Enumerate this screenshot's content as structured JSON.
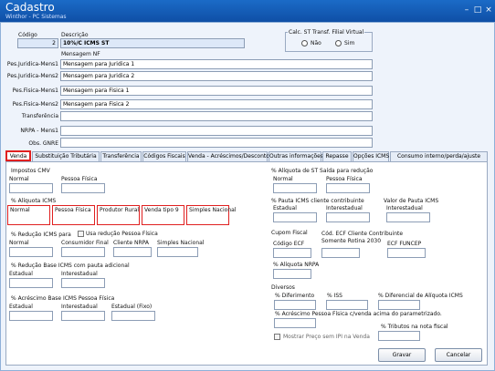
{
  "window": {
    "title": "Cadastro",
    "subtitle": "Winthor - PC Sistemas"
  },
  "header": {
    "codigo_label": "Código",
    "codigo_value": "2",
    "descricao_label": "Descrição",
    "descricao_value": "10%/C ICMS ST",
    "mensagem_nf_label": "Mensagem NF",
    "calc_st_label": "Calc. ST Transf. Filial Virtual",
    "nao_label": "Não",
    "sim_label": "Sim"
  },
  "fields": [
    {
      "label": "Pes.Juridica-Mens1",
      "value": "Mensagem para Juridica 1"
    },
    {
      "label": "Pes.Juridica-Mens2",
      "value": "Mensagem para Juridica 2"
    },
    {
      "label": "Pes.Fisica-Mens1",
      "value": "Mensagem para Fisica 1"
    },
    {
      "label": "Pes.Fisica-Mens2",
      "value": "Mensagem para Fisica 2"
    },
    {
      "label": "Transferência",
      "value": ""
    },
    {
      "label": "NRPA - Mens1",
      "value": ""
    },
    {
      "label": "Obs. GNRE",
      "value": ""
    }
  ],
  "tabs": [
    "Venda",
    "Substituição Tributária",
    "Transferência",
    "Códigos Fiscais",
    "Venda - Acréscimos/Descontos",
    "Outras informações",
    "Repasse",
    "Opções ICMS",
    "Consumo interno/perda/ajuste"
  ],
  "left": {
    "impostos_cmv": "Impostos CMV",
    "normal": "Normal",
    "pessoa_fisica": "Pessoa Física",
    "aliq_icms": "% Alíquota ICMS",
    "aliq_cols": [
      "Normal",
      "Pessoa Física",
      "Produtor Rural",
      "Venda tipo 9",
      "Simples Nacional"
    ],
    "reducao_icms": "% Redução ICMS para",
    "usa_reducao": "Usa redução Pessoa Física",
    "reducao_cols": [
      "Normal",
      "Consumidor Final",
      "Cliente NRPA",
      "Simples Nacional"
    ],
    "reducao_base": "% Redução Base ICMS com pauta adicional",
    "estadual": "Estadual",
    "interestadual": "Interestadual",
    "acrescimo": "% Acréscimo Base ICMS Pessoa Física",
    "estadual_fixo": "Estadual (Fixo)"
  },
  "right": {
    "aliq_st": "% Alíquota de ST Saída para redução",
    "normal": "Normal",
    "pessoa_fisica": "Pessoa Física",
    "pauta_icms": "% Pauta ICMS cliente contribuinte",
    "estadual": "Estadual",
    "interestadual": "Interestadual",
    "valor_pauta": "Valor de Pauta ICMS",
    "cupom_fiscal": "Cupom Fiscal",
    "codigo_ecf": "Código ECF",
    "cod_ecf_cli": "Cód. ECF Cliente Contribuinte",
    "somente_rotina": "Somente Rotina 2030",
    "ecf_funcep": "ECF FUNCEP",
    "aliq_nrpa": "% Alíquota NRPA",
    "diversos": "Diversos",
    "diferimento": "% Diferimento",
    "iss": "% ISS",
    "dif_aliq": "% Diferencial de Alíquota ICMS",
    "acrescimo_pf": "% Acréscimo Pessoa Física c/venda acima do parametrizado.",
    "tributos": "% Tributos na nota fiscal",
    "mostrar_preco": "Mostrar Preço sem IPI na Venda"
  },
  "buttons": {
    "gravar": "Gravar",
    "cancelar": "Cancelar"
  }
}
